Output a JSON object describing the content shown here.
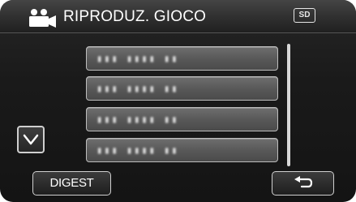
{
  "header": {
    "title": "RIPRODUZ. GIOCO",
    "mode_icon": "video-camera-icon",
    "media_badge": "SD"
  },
  "file_list": {
    "items": [
      {
        "label": "▮▮▮ ▮▮▮▮ ▮▮"
      },
      {
        "label": "▮▮▮ ▮▮▮▮ ▮▮"
      },
      {
        "label": "▮▮▮ ▮▮▮▮ ▮▮"
      },
      {
        "label": "▮▮▮ ▮▮▮▮ ▮▮"
      }
    ]
  },
  "controls": {
    "scroll_down_icon": "chevron-down-icon",
    "digest_label": "DIGEST",
    "back_icon": "return-arrow-icon"
  },
  "colors": {
    "screen_bg": "#1a1a1a",
    "header_bg": "#3a3a3a",
    "row_bg": "#5c5c5c",
    "row_border": "#bdbdbd",
    "text": "#ffffff"
  }
}
